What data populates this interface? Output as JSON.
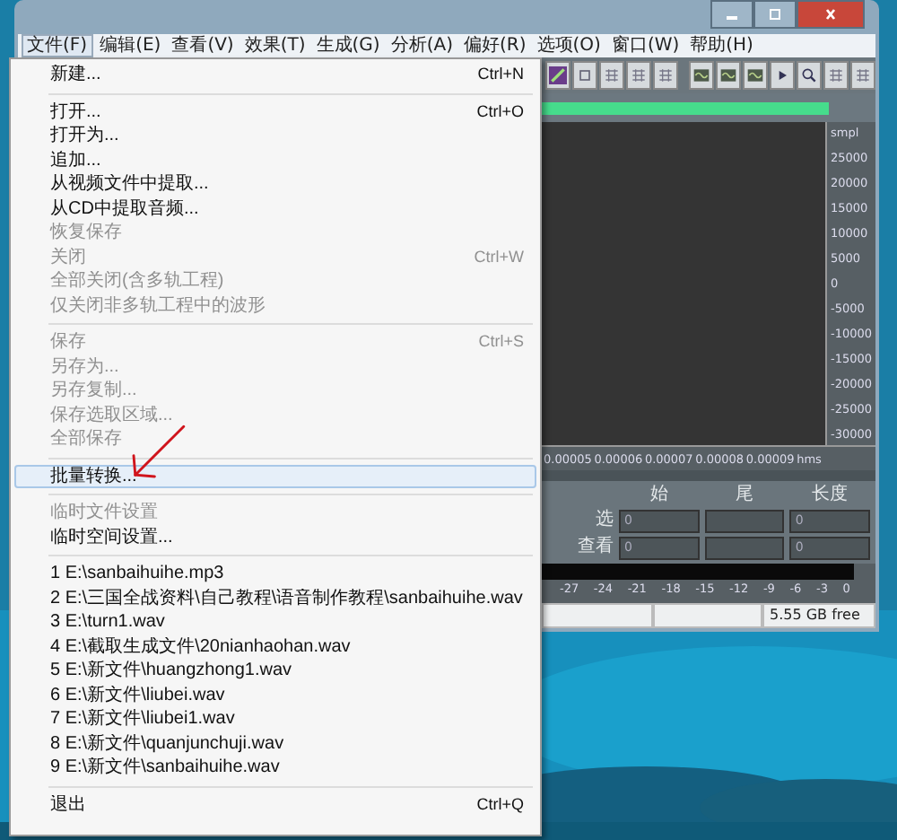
{
  "menubar": [
    {
      "label": "文件(F)",
      "selected": true
    },
    {
      "label": "编辑(E)",
      "selected": false
    },
    {
      "label": "查看(V)",
      "selected": false
    },
    {
      "label": "效果(T)",
      "selected": false
    },
    {
      "label": "生成(G)",
      "selected": false
    },
    {
      "label": "分析(A)",
      "selected": false
    },
    {
      "label": "偏好(R)",
      "selected": false
    },
    {
      "label": "选项(O)",
      "selected": false
    },
    {
      "label": "窗口(W)",
      "selected": false
    },
    {
      "label": "帮助(H)",
      "selected": false
    }
  ],
  "file_menu": {
    "items": [
      {
        "kind": "item",
        "label": "新建...",
        "shortcut": "Ctrl+N",
        "disabled": false,
        "selected": false
      },
      {
        "kind": "separator"
      },
      {
        "kind": "item",
        "label": "打开...",
        "shortcut": "Ctrl+O",
        "disabled": false,
        "selected": false
      },
      {
        "kind": "item",
        "label": "打开为...",
        "disabled": false,
        "selected": false
      },
      {
        "kind": "item",
        "label": "追加...",
        "disabled": false,
        "selected": false
      },
      {
        "kind": "item",
        "label": "从视频文件中提取...",
        "disabled": false,
        "selected": false
      },
      {
        "kind": "item",
        "label": "从CD中提取音频...",
        "disabled": false,
        "selected": false
      },
      {
        "kind": "item",
        "label": "恢复保存",
        "disabled": true,
        "selected": false
      },
      {
        "kind": "item",
        "label": "关闭",
        "shortcut": "Ctrl+W",
        "disabled": true,
        "selected": false
      },
      {
        "kind": "item",
        "label": "全部关闭(含多轨工程)",
        "disabled": true,
        "selected": false
      },
      {
        "kind": "item",
        "label": "仅关闭非多轨工程中的波形",
        "disabled": true,
        "selected": false
      },
      {
        "kind": "separator"
      },
      {
        "kind": "item",
        "label": "保存",
        "shortcut": "Ctrl+S",
        "disabled": true,
        "selected": false
      },
      {
        "kind": "item",
        "label": "另存为...",
        "disabled": true,
        "selected": false
      },
      {
        "kind": "item",
        "label": "另存复制...",
        "disabled": true,
        "selected": false
      },
      {
        "kind": "item",
        "label": "保存选取区域...",
        "disabled": true,
        "selected": false
      },
      {
        "kind": "item",
        "label": "全部保存",
        "disabled": true,
        "selected": false
      },
      {
        "kind": "separator"
      },
      {
        "kind": "item",
        "label": "批量转换...",
        "disabled": false,
        "selected": true
      },
      {
        "kind": "separator"
      },
      {
        "kind": "item",
        "label": "临时文件设置",
        "disabled": true,
        "selected": false
      },
      {
        "kind": "item",
        "label": "临时空间设置...",
        "disabled": false,
        "selected": false
      },
      {
        "kind": "separator"
      },
      {
        "kind": "item",
        "label": "1 E:\\sanbaihuihe.mp3",
        "disabled": false,
        "selected": false
      },
      {
        "kind": "item",
        "label": "2 E:\\三国全战资料\\自己教程\\语音制作教程\\sanbaihuihe.wav",
        "disabled": false,
        "selected": false
      },
      {
        "kind": "item",
        "label": "3 E:\\turn1.wav",
        "disabled": false,
        "selected": false
      },
      {
        "kind": "item",
        "label": "4 E:\\截取生成文件\\20nianhaohan.wav",
        "disabled": false,
        "selected": false
      },
      {
        "kind": "item",
        "label": "5 E:\\新文件\\huangzhong1.wav",
        "disabled": false,
        "selected": false
      },
      {
        "kind": "item",
        "label": "6 E:\\新文件\\liubei.wav",
        "disabled": false,
        "selected": false
      },
      {
        "kind": "item",
        "label": "7 E:\\新文件\\liubei1.wav",
        "disabled": false,
        "selected": false
      },
      {
        "kind": "item",
        "label": "8 E:\\新文件\\quanjunchuji.wav",
        "disabled": false,
        "selected": false
      },
      {
        "kind": "item",
        "label": "9 E:\\新文件\\sanbaihuihe.wav",
        "disabled": false,
        "selected": false
      },
      {
        "kind": "separator"
      },
      {
        "kind": "item",
        "label": "退出",
        "shortcut": "Ctrl+Q",
        "disabled": false,
        "selected": false
      }
    ]
  },
  "waveform": {
    "amplitude_labels": [
      "smpl",
      "25000",
      "20000",
      "15000",
      "10000",
      "5000",
      "0",
      "-5000",
      "-10000",
      "-15000",
      "-20000",
      "-25000",
      "-30000"
    ],
    "time_labels": [
      "0.00005",
      "0.00006",
      "0.00007",
      "0.00008",
      "0.00009",
      "hms"
    ]
  },
  "selection_panel": {
    "columns": [
      "始",
      "尾",
      "长度"
    ],
    "rows": [
      {
        "label": "选",
        "start": "0",
        "length": "0"
      },
      {
        "label": "查看",
        "start": "0",
        "length": "0"
      }
    ]
  },
  "level_meter": {
    "scale": [
      "-27",
      "-24",
      "-21",
      "-18",
      "-15",
      "-12",
      "-9",
      "-6",
      "-3",
      "0"
    ]
  },
  "status_bar": {
    "free_space": "5.55 GB free"
  }
}
